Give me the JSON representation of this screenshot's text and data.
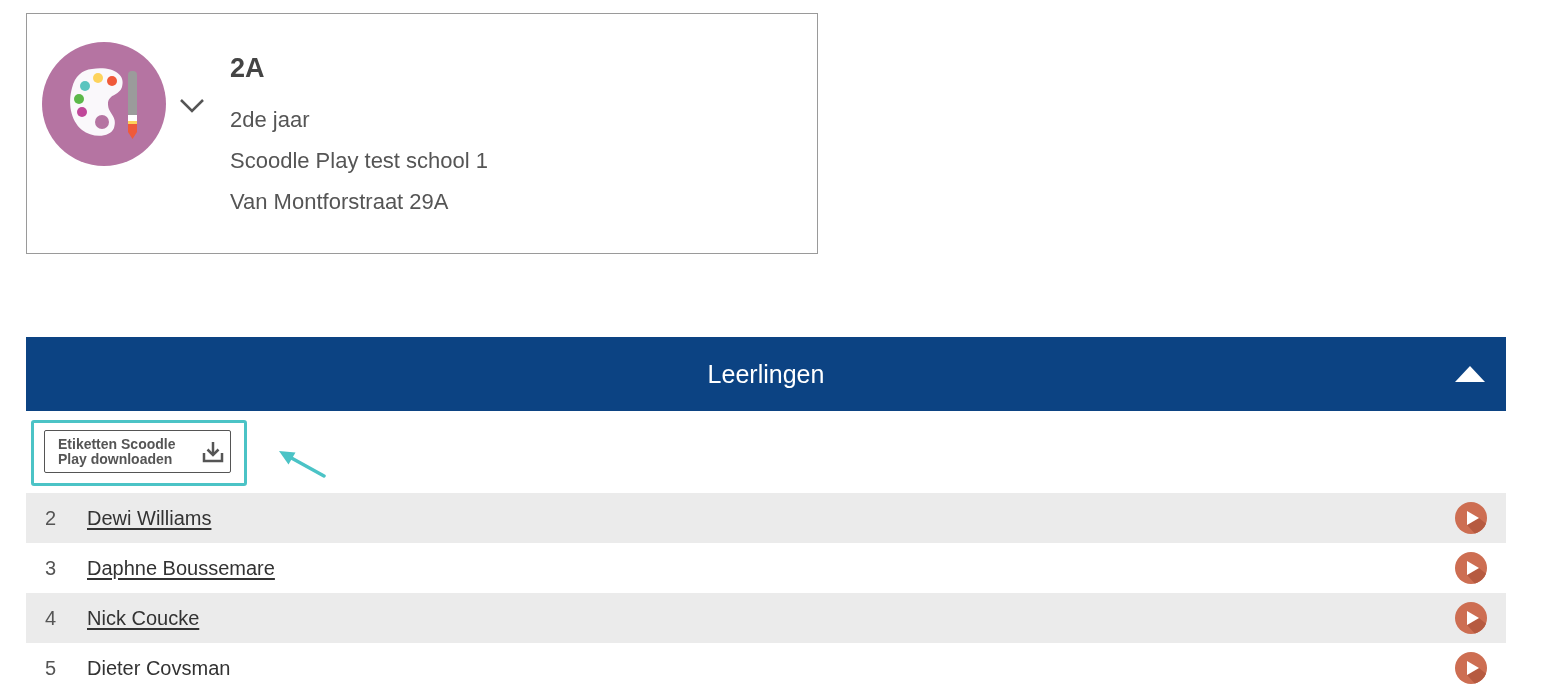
{
  "class_card": {
    "title": "2A",
    "details": [
      "2de jaar",
      "Scoodle Play test school 1",
      "Van Montforstraat 29A"
    ]
  },
  "students_panel": {
    "title": "Leerlingen",
    "expanded": true,
    "download_button": {
      "label": "Etiketten Scoodle Play downloaden",
      "highlighted": true
    },
    "students": [
      {
        "number": "2",
        "name": "Dewi Williams",
        "linked": true
      },
      {
        "number": "3",
        "name": "Daphne Boussemare",
        "linked": true
      },
      {
        "number": "4",
        "name": "Nick Coucke",
        "linked": true
      },
      {
        "number": "5",
        "name": "Dieter Covsman",
        "linked": false
      }
    ]
  }
}
